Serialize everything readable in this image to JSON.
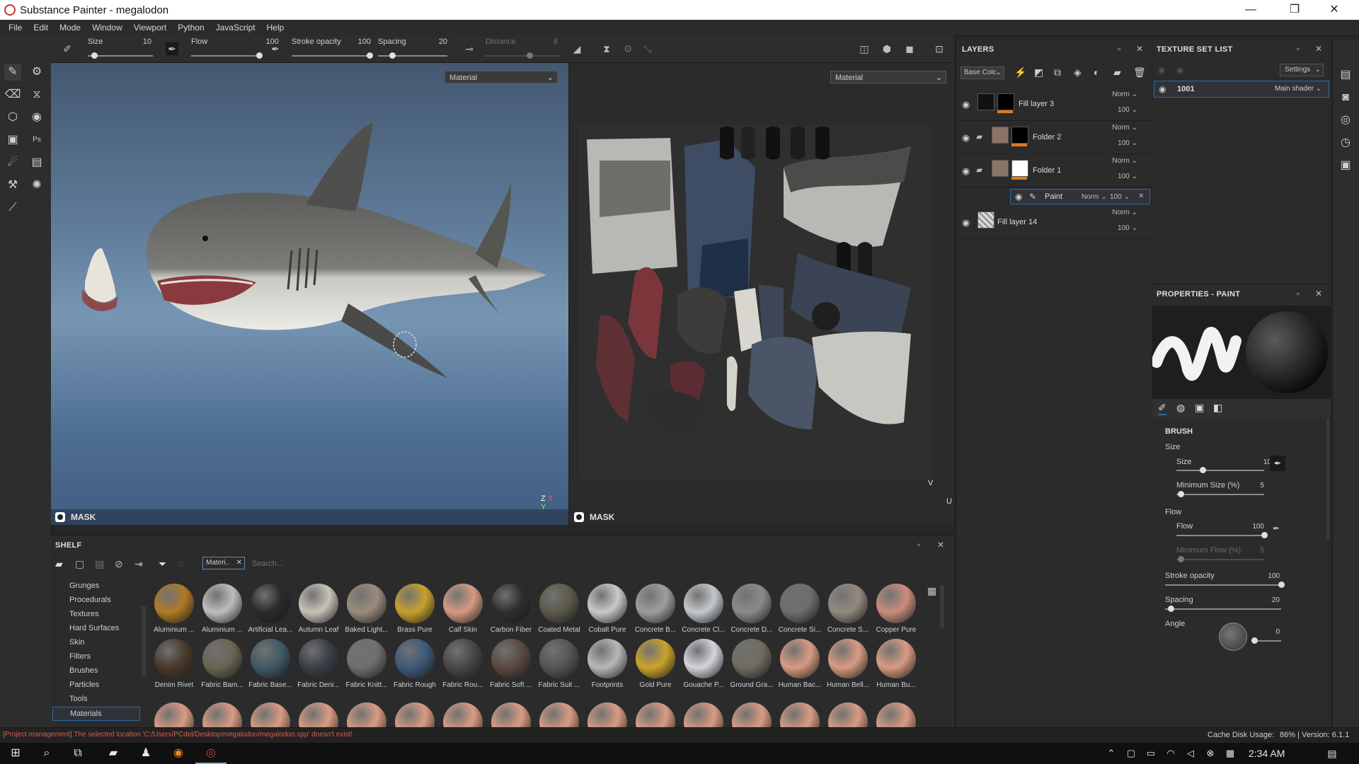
{
  "window": {
    "title": "Substance Painter - megalodon",
    "minimize": "—",
    "maximize": "❐",
    "close": "✕"
  },
  "menu": [
    "File",
    "Edit",
    "Mode",
    "Window",
    "Viewport",
    "Python",
    "JavaScript",
    "Help"
  ],
  "toolbar": {
    "size_label": "Size",
    "size_value": "10",
    "size_fill": 0.1,
    "flow_label": "Flow",
    "flow_value": "100",
    "flow_fill": 1.0,
    "stroke_opacity_label": "Stroke opacity",
    "stroke_opacity_value": "100",
    "stroke_opacity_fill": 1.0,
    "spacing_label": "Spacing",
    "spacing_value": "20",
    "spacing_fill": 0.2,
    "distance_label": "Distance",
    "distance_value": "8"
  },
  "viewport3d": {
    "mode": "Material",
    "mask_label": "MASK",
    "gizmo_z": "Z",
    "gizmo_x": "X",
    "gizmo_y": "Y"
  },
  "viewport2d": {
    "mode": "Material",
    "mask_label": "MASK",
    "axis_v": "V",
    "axis_u": "U"
  },
  "shelf": {
    "title": "SHELF",
    "filter_chip": "Materi..",
    "search_placeholder": "Search...",
    "categories": [
      "Grunges",
      "Procedurals",
      "Textures",
      "Hard Surfaces",
      "Skin",
      "Filters",
      "Brushes",
      "Particles",
      "Tools",
      "Materials"
    ],
    "selected_category": "Materials",
    "materials_row1": [
      {
        "name": "Aluminium ...",
        "color": "#b07a25"
      },
      {
        "name": "Aluminium ...",
        "color": "#bdbdbd"
      },
      {
        "name": "Artificial Lea...",
        "color": "#2a2a2a"
      },
      {
        "name": "Autumn Leaf",
        "color": "#c9c1b8"
      },
      {
        "name": "Baked Light...",
        "color": "#9a8c7c"
      },
      {
        "name": "Brass Pure",
        "color": "#c7a12e"
      },
      {
        "name": "Calf Skin",
        "color": "#d59a82"
      },
      {
        "name": "Carbon Fiber",
        "color": "#2e2e2e"
      },
      {
        "name": "Coated Metal",
        "color": "#5b5a4a"
      },
      {
        "name": "Cobalt Pure",
        "color": "#c9c9c9"
      },
      {
        "name": "Concrete B...",
        "color": "#9e9e9e"
      },
      {
        "name": "Concrete Cl...",
        "color": "#c4c8cc"
      },
      {
        "name": "Concrete D...",
        "color": "#8b8b8b"
      },
      {
        "name": "Concrete Si...",
        "color": "#6d6d6d"
      },
      {
        "name": "Concrete S...",
        "color": "#938a7e"
      },
      {
        "name": "Copper Pure",
        "color": "#c98d7c"
      }
    ],
    "materials_row2": [
      {
        "name": "Denim Rivet",
        "color": "#4a3a2a"
      },
      {
        "name": "Fabric Bam...",
        "color": "#6a6552"
      },
      {
        "name": "Fabric Base...",
        "color": "#3f5a66"
      },
      {
        "name": "Fabric Deni...",
        "color": "#3a4048"
      },
      {
        "name": "Fabric Knitt...",
        "color": "#6f6f6f"
      },
      {
        "name": "Fabric Rough",
        "color": "#3d5a7a"
      },
      {
        "name": "Fabric Rou...",
        "color": "#484848"
      },
      {
        "name": "Fabric Soft ...",
        "color": "#5a4a40"
      },
      {
        "name": "Fabric Suit ...",
        "color": "#555558"
      },
      {
        "name": "Footprints",
        "color": "#b8b8b8"
      },
      {
        "name": "Gold Pure",
        "color": "#c9a42a"
      },
      {
        "name": "Gouache P...",
        "color": "#d6d2dc"
      },
      {
        "name": "Ground Gra...",
        "color": "#6f6c60"
      },
      {
        "name": "Human Bac...",
        "color": "#d99b82"
      },
      {
        "name": "Human Bell...",
        "color": "#d99b82"
      },
      {
        "name": "Human Bu...",
        "color": "#d99b82"
      }
    ]
  },
  "layers": {
    "title": "LAYERS",
    "channel": "Base Colc",
    "items": [
      {
        "name": "Fill layer 3",
        "blend": "Norm",
        "opacity": "100"
      },
      {
        "name": "Folder 2",
        "blend": "Norm",
        "opacity": "100"
      },
      {
        "name": "Folder 1",
        "blend": "Norm",
        "opacity": "100"
      },
      {
        "name": "Paint",
        "blend": "Norm",
        "opacity": "100"
      },
      {
        "name": "Fill layer 14",
        "blend": "Norm",
        "opacity": "100"
      }
    ]
  },
  "texture_set": {
    "title": "TEXTURE SET LIST",
    "settings": "Settings",
    "item": "1001",
    "shader": "Main shader"
  },
  "properties": {
    "title": "PROPERTIES - PAINT",
    "section": "BRUSH",
    "size_group": "Size",
    "size_label": "Size",
    "size_value": "10",
    "size_fill": 0.3,
    "min_size_label": "Minimum Size (%)",
    "min_size_value": "5",
    "min_size_fill": 0.05,
    "flow_group": "Flow",
    "flow_label": "Flow",
    "flow_value": "100",
    "flow_fill": 1.0,
    "min_flow_label": "Minimum Flow (%)",
    "min_flow_value": "5",
    "min_flow_fill": 0.05,
    "stroke_opacity_label": "Stroke opacity",
    "stroke_opacity_value": "100",
    "stroke_opacity_fill": 1.0,
    "spacing_label": "Spacing",
    "spacing_value": "20",
    "spacing_fill": 0.05,
    "angle_label": "Angle",
    "angle_value": "0"
  },
  "status": {
    "message": "[Project management] The selected location 'C:/Users/PCdel/Desktop/megalodon/megalodon.spp' doesn't exist!",
    "cache": "Cache Disk Usage:",
    "cache_value": "86% | Version: 6.1.1"
  },
  "taskbar": {
    "time": "2:34 AM"
  },
  "colors": {
    "accent_orange": "#e07a1f",
    "error_red": "#e05a4a",
    "selection_blue": "#2d6aa3"
  }
}
